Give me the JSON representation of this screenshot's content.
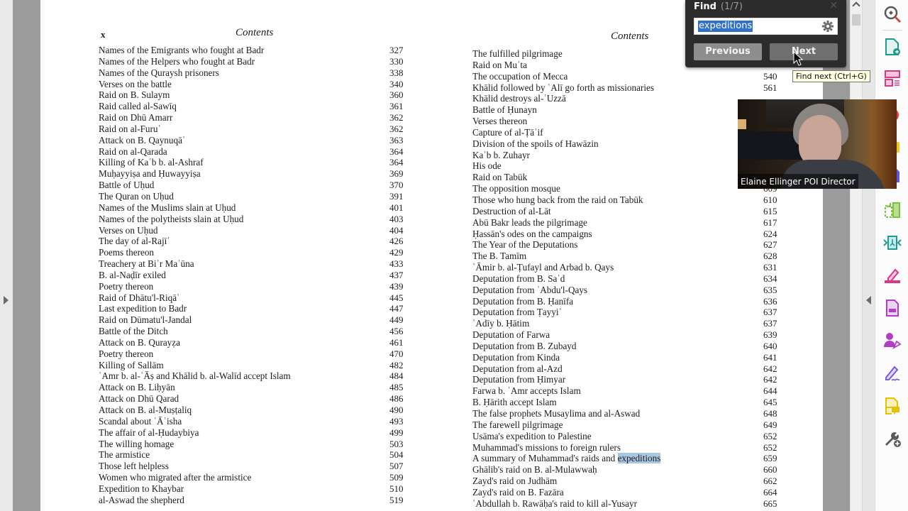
{
  "find": {
    "title": "Find",
    "count": "(1/7)",
    "query": "expeditions",
    "previous_label": "Previous",
    "next_label": "Next",
    "tooltip": "Find next (Ctrl+G)"
  },
  "video": {
    "participant_name": "Elaine Ellinger POI Director"
  },
  "tools": [
    {
      "name": "search-zoom-icon",
      "color": "#5a5a5a"
    },
    {
      "name": "export-pdf-icon",
      "color": "#1e9a8c"
    },
    {
      "name": "organize-pages-icon",
      "color": "#d6388a"
    },
    {
      "name": "edit-pdf-icon",
      "color": "#e33b3b"
    },
    {
      "name": "comment-icon",
      "color": "#f3c51c"
    },
    {
      "name": "combine-files-icon",
      "color": "#5b57e0"
    },
    {
      "name": "compress-pdf-icon",
      "color": "#7cc242"
    },
    {
      "name": "optimize-pdf-icon",
      "color": "#1e9a9a"
    },
    {
      "name": "fill-sign-icon",
      "color": "#d6388a"
    },
    {
      "name": "protect-icon",
      "color": "#b23dc7"
    },
    {
      "name": "request-signature-icon",
      "color": "#b23dc7"
    },
    {
      "name": "sign-icon",
      "color": "#7b5cd6"
    },
    {
      "name": "send-comments-icon",
      "color": "#e5c100"
    },
    {
      "name": "more-tools-icon",
      "color": "#5a5a5a"
    }
  ],
  "left_page": {
    "folio": "x",
    "header": "Contents",
    "entries": [
      {
        "title": "Names of the Emigrants who fought at Badr",
        "page": "327"
      },
      {
        "title": "Names of the Helpers who fought at Badr",
        "page": "330"
      },
      {
        "title": "Names of the Quraysh prisoners",
        "page": "338"
      },
      {
        "title": "Verses on the battle",
        "page": "340"
      },
      {
        "title": "Raid on B. Sulaym",
        "page": "360"
      },
      {
        "title": "Raid called al-Sawīq",
        "page": "361"
      },
      {
        "title": "Raid on Dhū Amarr",
        "page": "362"
      },
      {
        "title": "Raid on al-Furuʿ",
        "page": "362"
      },
      {
        "title": "Attack on B. Qaynuqāʿ",
        "page": "363"
      },
      {
        "title": "Raid on al-Qarada",
        "page": "364"
      },
      {
        "title": "Killing of Kaʿb b. al-Ashraf",
        "page": "364"
      },
      {
        "title": "Muḥayyiṣa and Ḥuwayyiṣa",
        "page": "369"
      },
      {
        "title": "Battle of Uḥud",
        "page": "370"
      },
      {
        "title": "The Quran on Uḥud",
        "page": "391"
      },
      {
        "title": "Names of the Muslims slain at Uḥud",
        "page": "401"
      },
      {
        "title": "Names of the polytheists slain at Uḥud",
        "page": "403"
      },
      {
        "title": "Verses on Uḥud",
        "page": "404"
      },
      {
        "title": "The day of al-Rajīʿ",
        "page": "426"
      },
      {
        "title": "Poems thereon",
        "page": "429"
      },
      {
        "title": "Treachery at Biʾr Maʿūna",
        "page": "433"
      },
      {
        "title": "B. al-Naḍīr exiled",
        "page": "437"
      },
      {
        "title": "Poetry thereon",
        "page": "439"
      },
      {
        "title": "Raid of Dhātu'l-Riqāʿ",
        "page": "445"
      },
      {
        "title": "Last expedition to Badr",
        "page": "447"
      },
      {
        "title": "Raid on Dūmatu'l-Jandal",
        "page": "449"
      },
      {
        "title": "Battle of the Ditch",
        "page": "456"
      },
      {
        "title": "Attack on B. Qurayẓa",
        "page": "461"
      },
      {
        "title": "Poetry thereon",
        "page": "470"
      },
      {
        "title": "Killing of Sallām",
        "page": "482"
      },
      {
        "title": "ʿAmr b. al-ʿĀṣ and Khālid b. al-Walīd accept Islam",
        "page": "484"
      },
      {
        "title": "Attack on B. Liḥyān",
        "page": "485"
      },
      {
        "title": "Attack on Dhū Qarad",
        "page": "486"
      },
      {
        "title": "Attack on B. al-Muṣṭaliq",
        "page": "490"
      },
      {
        "title": "Scandal about ʿĀʾisha",
        "page": "493"
      },
      {
        "title": "The affair of al-Ḥudaybiya",
        "page": "499"
      },
      {
        "title": "The willing homage",
        "page": "503"
      },
      {
        "title": "The armistice",
        "page": "504"
      },
      {
        "title": "Those left helpless",
        "page": "507"
      },
      {
        "title": "Women who migrated after the armistice",
        "page": "509"
      },
      {
        "title": "Expedition to Khaybar",
        "page": "510"
      },
      {
        "title": "al-Aswad the shepherd",
        "page": "519"
      }
    ]
  },
  "right_page": {
    "header": "Contents",
    "entries": [
      {
        "title": "The fulfilled pilgrimage",
        "page": ""
      },
      {
        "title": "Raid on Muʾta",
        "page": ""
      },
      {
        "title": "The occupation of Mecca",
        "page": "540"
      },
      {
        "title": "Khālid followed by ʿAlī go forth as missionaries",
        "page": "561"
      },
      {
        "title": "Khālid destroys al-ʿUzzā",
        "page": ""
      },
      {
        "title": "Battle of Ḥunayn",
        "page": ""
      },
      {
        "title": "Verses thereon",
        "page": ""
      },
      {
        "title": "Capture of al-Ṭāʾif",
        "page": ""
      },
      {
        "title": "Division of the spoils of Hawāzin",
        "page": ""
      },
      {
        "title": "Kaʿb b. Zuhayr",
        "page": ""
      },
      {
        "title": "His ode",
        "page": ""
      },
      {
        "title": "Raid on Tabūk",
        "page": ""
      },
      {
        "title": "The opposition mosque",
        "page": "609"
      },
      {
        "title": "Those who hung back from the raid on Tabūk",
        "page": "610"
      },
      {
        "title": "Destruction of al-Lāt",
        "page": "615"
      },
      {
        "title": "Abū Bakr leads the pilgrimage",
        "page": "617"
      },
      {
        "title": "Ḥassān's odes on the campaigns",
        "page": "624"
      },
      {
        "title": "The Year of the Deputations",
        "page": "627"
      },
      {
        "title": "The B. Tamīm",
        "page": "628"
      },
      {
        "title": "ʿĀmir b. al-Ṭufayl and Arbad b. Qays",
        "page": "631"
      },
      {
        "title": "Deputation from B. Saʿd",
        "page": "634"
      },
      {
        "title": "Deputation from ʿAbdu'l-Qays",
        "page": "635"
      },
      {
        "title": "Deputation from B. Ḥanīfa",
        "page": "636"
      },
      {
        "title": "Deputation from Ṭayyiʾ",
        "page": "637"
      },
      {
        "title": "ʿAdīy b. Ḥātim",
        "page": "637"
      },
      {
        "title": "Deputation of Farwa",
        "page": "639"
      },
      {
        "title": "Deputation from B. Zubayd",
        "page": "640"
      },
      {
        "title": "Deputation from Kinda",
        "page": "641"
      },
      {
        "title": "Deputation from al-Azd",
        "page": "642"
      },
      {
        "title": "Deputation from Ḥimyar",
        "page": "642"
      },
      {
        "title": "Farwa b. ʿAmr accepts Islam",
        "page": "644"
      },
      {
        "title": "B. Ḥārith accept Islam",
        "page": "645"
      },
      {
        "title": "The false prophets Musaylima and al-Aswad",
        "page": "648"
      },
      {
        "title": "The farewell pilgrimage",
        "page": "649"
      },
      {
        "title": "Usāma's expedition to Palestine",
        "page": "652"
      },
      {
        "title": "Muhammad's missions to foreign rulers",
        "page": "652"
      },
      {
        "title": "A summary of Muhammad's raids and ",
        "highlight": "expeditions",
        "page": "659"
      },
      {
        "title": "Ghālib's raid on B. al-Mulawwaḥ",
        "page": "660"
      },
      {
        "title": "Zayd's raid on Judhām",
        "page": "662"
      },
      {
        "title": "Zayd's raid on B. Fazāra",
        "page": "664"
      },
      {
        "title": "ʿAbdullah b. Rawāḥa's raid to kill al-Yusayr",
        "page": "665"
      }
    ]
  }
}
